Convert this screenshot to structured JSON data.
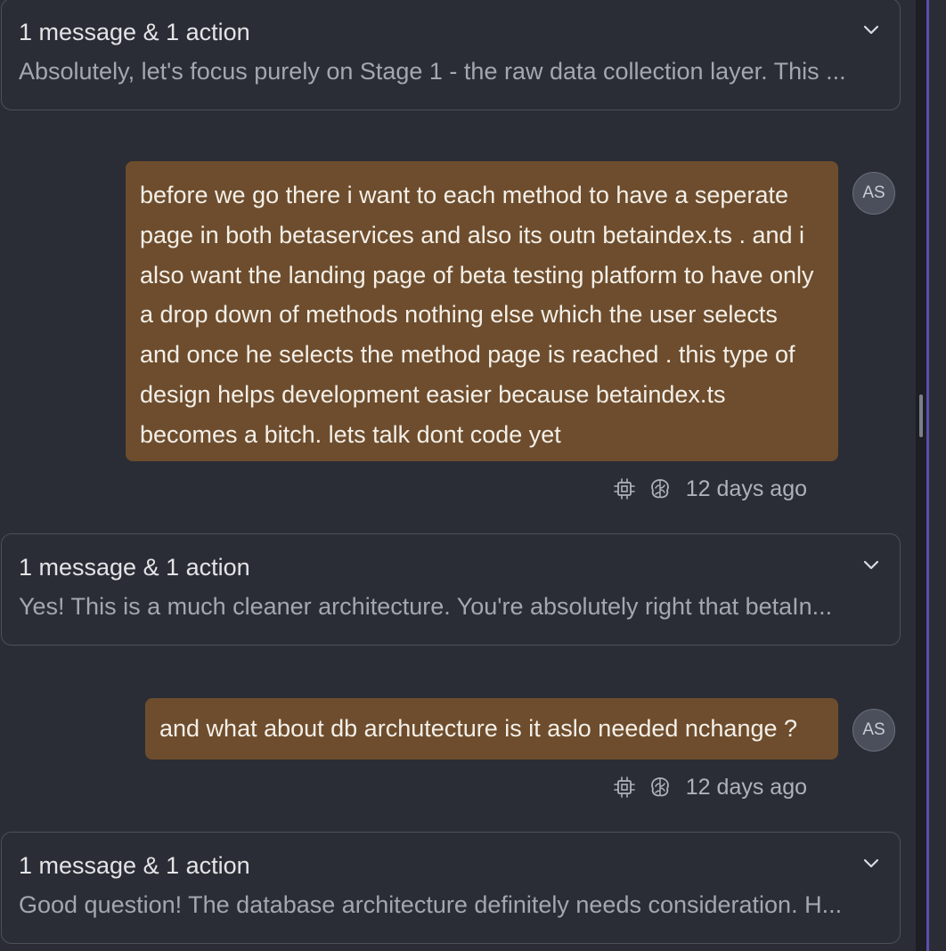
{
  "threads": [
    {
      "title": "1 message & 1 action",
      "preview": "Absolutely, let's focus purely on Stage 1 - the raw data collection layer. This ..."
    },
    {
      "title": "1 message & 1 action",
      "preview": "Yes! This is a much cleaner architecture. You're absolutely right that betaIn..."
    },
    {
      "title": "1 message & 1 action",
      "preview": "Good question! The database architecture definitely needs consideration. H..."
    }
  ],
  "user_messages": [
    {
      "text": "before we go there i want to each method to have a seperate page in both betaservices and also its outn betaindex.ts . and i also want the landing page of beta testing platform to have only a drop down of methods nothing else which the user selects and once he selects the method page is reached . this type of design helps development easier because betaindex.ts becomes a bitch. lets talk dont code yet",
      "avatar": "AS",
      "time": "12 days ago"
    },
    {
      "text": "and what about db archutecture is it aslo needed nchange ?",
      "avatar": "AS",
      "time": "12 days ago"
    }
  ],
  "icons": {
    "chip": "cpu-chip-icon",
    "brain": "brain-icon",
    "chevron": "chevron-down-icon"
  },
  "colors": {
    "background": "#2a2d35",
    "user_bubble": "#6d4d2d",
    "card_border": "#4b505b",
    "accent_edge": "#5b4fb0"
  }
}
